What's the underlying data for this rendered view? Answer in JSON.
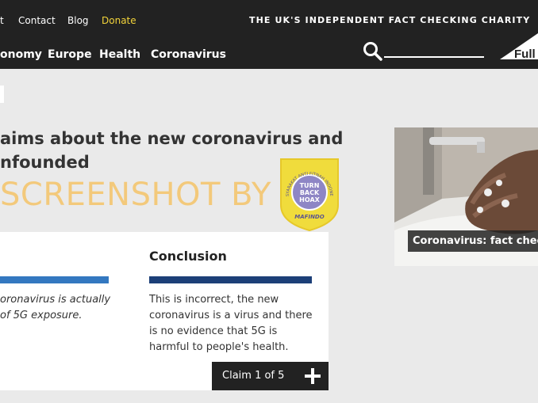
{
  "header": {
    "utility_links": [
      "t",
      "Contact",
      "Blog"
    ],
    "donate_label": "Donate",
    "tagline": "THE UK'S INDEPENDENT FACT CHECKING CHARITY",
    "nav": [
      "onomy",
      "Europe",
      "Health",
      "Coronavirus"
    ],
    "search_icon": "search-icon",
    "logo_text": "Full",
    "colors": {
      "bar": "#222222",
      "donate": "#f2d33a"
    }
  },
  "article": {
    "headline_line1": "aims about the new coronavirus and",
    "headline_line2": "nfounded",
    "watermark": "SCREENSHOT BY",
    "badge": {
      "top_text": "MASYARAKAT ANTI FITNAH INDONESIA",
      "center_line1": "TURN",
      "center_line2": "BACK",
      "center_line3": "HOAX",
      "bottom_text": "MAFINDO"
    }
  },
  "claim": {
    "claim_text": "oronavirus is actually of 5G exposure.",
    "claim_bar_color": "#3378c0",
    "conclusion_title": "Conclusion",
    "conclusion_bar_color": "#1c3f78",
    "conclusion_text": "This is incorrect, the new coronavirus is a virus and there is no evidence that 5G is harmful to people's health.",
    "pager_label": "Claim 1 of 5",
    "pager_icon": "plus-icon"
  },
  "related": {
    "caption": "Coronavirus: fact check"
  }
}
